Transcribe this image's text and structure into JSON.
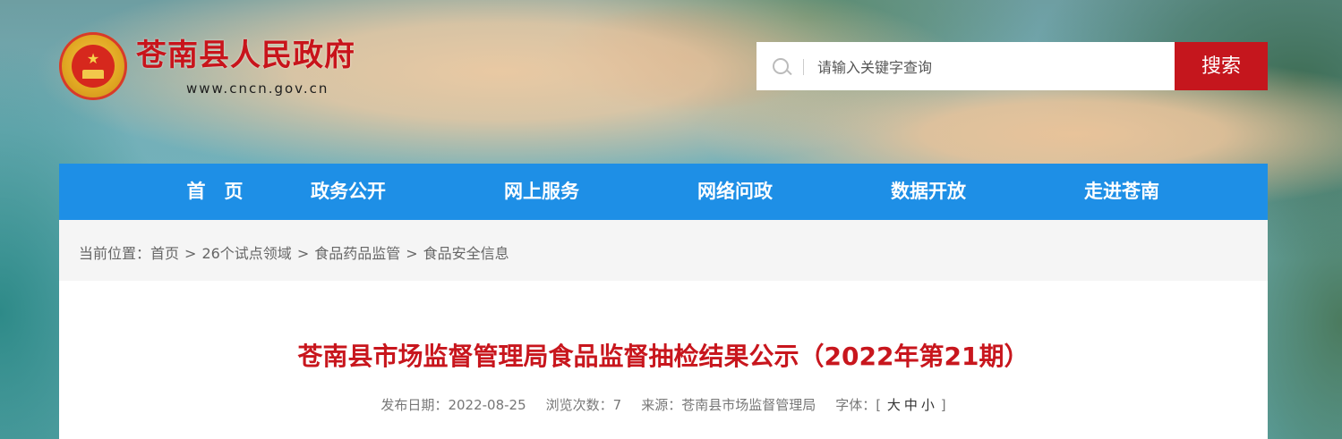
{
  "header": {
    "site_title": "苍南县人民政府",
    "site_url": "www.cncn.gov.cn"
  },
  "search": {
    "placeholder": "请输入关键字查询",
    "button_label": "搜索"
  },
  "nav": {
    "items": [
      {
        "label": "首　页"
      },
      {
        "label": "政务公开"
      },
      {
        "label": "网上服务"
      },
      {
        "label": "网络问政"
      },
      {
        "label": "数据开放"
      },
      {
        "label": "走进苍南"
      }
    ]
  },
  "breadcrumb": {
    "prefix": "当前位置：",
    "items": [
      "首页",
      "26个试点领域",
      "食品药品监管",
      "食品安全信息"
    ],
    "separator": ">"
  },
  "article": {
    "title": "苍南县市场监督管理局食品监督抽检结果公示（2022年第21期）",
    "publish_label": "发布日期：",
    "publish_date": "2022-08-25",
    "views_label": "浏览次数：",
    "views": "7",
    "source_label": "来源：",
    "source": "苍南县市场监督管理局",
    "font_label": "字体：",
    "font_open": "[",
    "font_large": "大",
    "font_medium": "中",
    "font_small": "小",
    "font_close": "]"
  },
  "colors": {
    "nav_bg": "#1e8fe6",
    "brand_red": "#c5161d"
  }
}
